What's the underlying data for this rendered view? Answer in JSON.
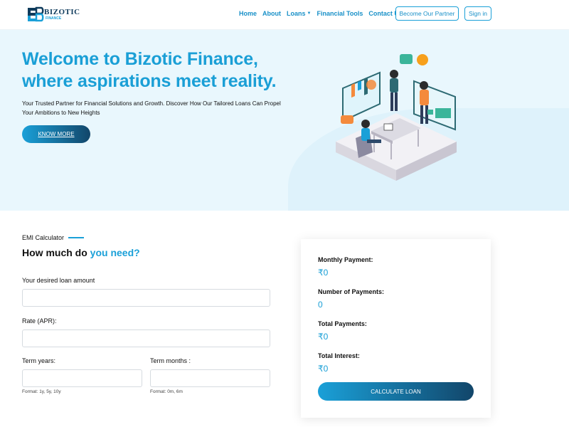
{
  "header": {
    "logo_text": "BIZOTIC",
    "logo_sub": "FINANCE",
    "nav": [
      {
        "label": "Home"
      },
      {
        "label": "About"
      },
      {
        "label": "Loans"
      },
      {
        "label": "Financial Tools"
      },
      {
        "label": "Contact Us"
      }
    ],
    "partner_label": "Become Our Partner",
    "signin_label": "Sign in"
  },
  "hero": {
    "title_line1": "Welcome to Bizotic Finance,",
    "title_line2": "where aspirations meet reality.",
    "subtitle": "Your Trusted Partner for Financial Solutions and Growth. Discover How Our Tailored Loans Can Propel Your Ambitions to New Heights",
    "cta_label": "KNOW MORE"
  },
  "emi": {
    "eyebrow": "EMI Calculator",
    "heading_prefix": "How much do ",
    "heading_accent": "you need?",
    "loan_amount_label": "Your desired loan amount",
    "loan_amount_value": "",
    "rate_label": "Rate (APR):",
    "rate_value": "",
    "term_years_label": "Term years:",
    "term_years_value": "",
    "term_years_hint": "Format: 1y, 5y, 10y",
    "term_months_label": "Term months :",
    "term_months_value": "",
    "term_months_hint": "Format: 0m, 6m"
  },
  "results": {
    "monthly_label": "Monthly Payment:",
    "monthly_value": "₹0",
    "num_payments_label": "Number of Payments:",
    "num_payments_value": "0",
    "total_payments_label": "Total Payments:",
    "total_payments_value": "₹0",
    "total_interest_label": "Total Interest:",
    "total_interest_value": "₹0",
    "calc_label": "CALCULATE LOAN"
  },
  "colors": {
    "brand_blue": "#1a9fd6",
    "brand_navy": "#12466a",
    "hero_bg": "#e9f7fd"
  },
  "icons": {
    "logo": "bizotic-logo-icon",
    "loans_caret": "caret-down-icon",
    "illustration": "team-office-illustration"
  }
}
